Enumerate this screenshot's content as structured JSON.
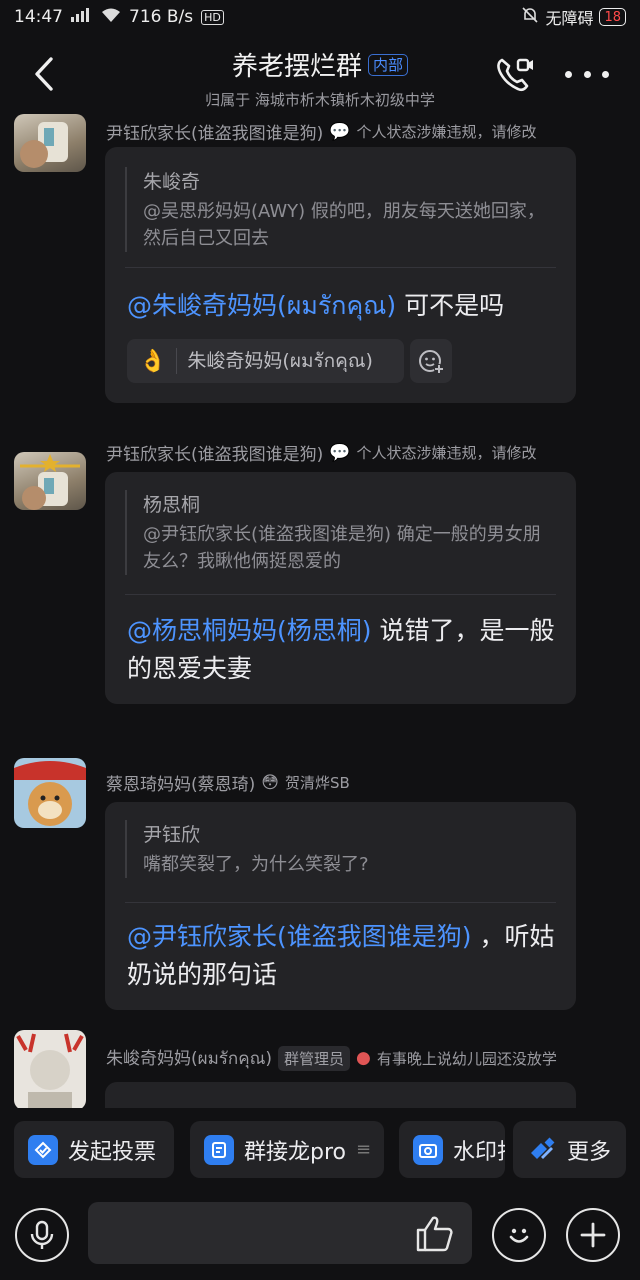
{
  "status_bar": {
    "time": "14:47",
    "network": "716 B/s",
    "accessibility": "无障碍",
    "battery": "18"
  },
  "header": {
    "title": "养老摆烂群",
    "tag": "内部",
    "subtitle": "归属于 海城市析木镇析木初级中学"
  },
  "messages": [
    {
      "sender": "尹钰欣家长(谁盗我图谁是狗)",
      "status_text": "个人状态涉嫌违规，请修改",
      "quote_name": "朱峻奇",
      "quote_text": "@吴思彤妈妈(AWY) 假的吧，朋友每天送她回家，然后自己又回去",
      "reply_mention": "@朱峻奇妈妈(ผมรักคุณ)",
      "reply_text": " 可不是吗",
      "reaction_name": "朱峻奇妈妈(ผมรักคุณ)"
    },
    {
      "sender": "尹钰欣家长(谁盗我图谁是狗)",
      "status_text": "个人状态涉嫌违规，请修改",
      "quote_name": "杨思桐",
      "quote_text": "@尹钰欣家长(谁盗我图谁是狗) 确定一般的男女朋友么？我瞅他俩挺恩爱的",
      "reply_mention": "@杨思桐妈妈(杨思桐)",
      "reply_text": " 说错了，是一般的恩爱夫妻"
    },
    {
      "sender": "蔡恩琦妈妈(蔡恩琦)",
      "status_text": "贺清烨SB",
      "quote_name": "尹钰欣",
      "quote_text": "嘴都笑裂了，为什么笑裂了?",
      "reply_mention": "@尹钰欣家长(谁盗我图谁是狗)",
      "reply_text": " ，听姑奶说的那句话"
    },
    {
      "sender": "朱峻奇妈妈(ผมรักคุณ)",
      "badge": "群管理员",
      "status_text": "有事晚上说幼儿园还没放学"
    }
  ],
  "quick_actions": [
    {
      "label": "发起投票",
      "icon": "vote-icon"
    },
    {
      "label": "群接龙pro",
      "icon": "relay-icon"
    },
    {
      "label": "水印打卡",
      "icon": "camera-icon"
    },
    {
      "label": "更多",
      "icon": "apps-icon"
    }
  ],
  "colors": {
    "background": "#111113",
    "bubble": "#232326",
    "mention": "#4d94ff",
    "accent": "#2f7ef0"
  }
}
